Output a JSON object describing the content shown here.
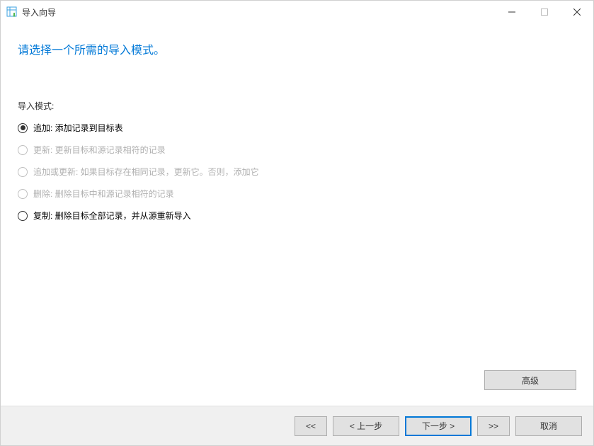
{
  "window": {
    "title": "导入向导"
  },
  "instruction": "请选择一个所需的导入模式。",
  "section_label": "导入模式:",
  "modes": [
    {
      "label": "追加: 添加记录到目标表",
      "selected": true,
      "enabled": true
    },
    {
      "label": "更新: 更新目标和源记录相符的记录",
      "selected": false,
      "enabled": false
    },
    {
      "label": "追加或更新: 如果目标存在相同记录，更新它。否则，添加它",
      "selected": false,
      "enabled": false
    },
    {
      "label": "删除: 删除目标中和源记录相符的记录",
      "selected": false,
      "enabled": false
    },
    {
      "label": "复制: 删除目标全部记录，并从源重新导入",
      "selected": false,
      "enabled": true
    }
  ],
  "buttons": {
    "advanced": "高级",
    "first": "<<",
    "prev": "< 上一步",
    "next": "下一步 >",
    "last": ">>",
    "cancel": "取消"
  }
}
